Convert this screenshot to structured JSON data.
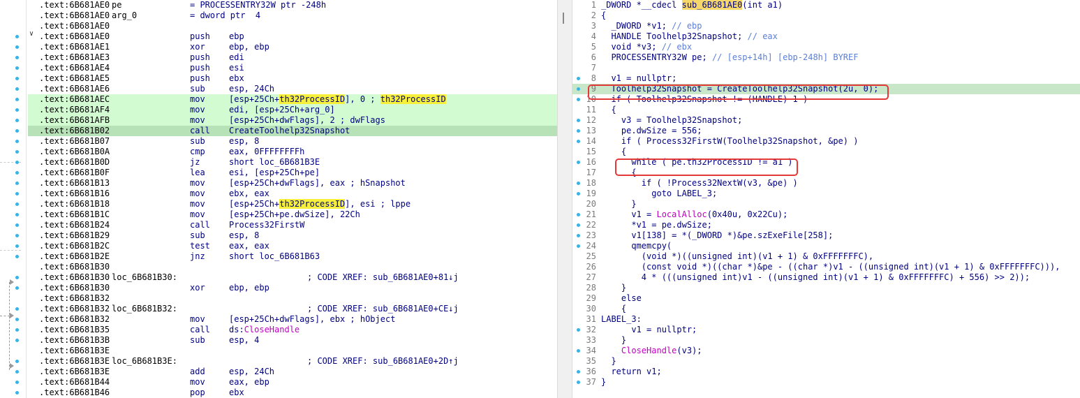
{
  "asm": {
    "lines": [
      {
        "addr": ".text:6B681AE0",
        "label": "pe",
        "plain": "= PROCESSENTRY32W ptr -248h"
      },
      {
        "addr": ".text:6B681AE0",
        "label": "arg_0",
        "plain": "= dword ptr  4"
      },
      {
        "addr": ".text:6B681AE0"
      },
      {
        "addr": ".text:6B681AE0",
        "mnem": "push",
        "ops": "ebp"
      },
      {
        "addr": ".text:6B681AE1",
        "mnem": "xor",
        "ops": "ebp, ebp"
      },
      {
        "addr": ".text:6B681AE3",
        "mnem": "push",
        "ops": "edi"
      },
      {
        "addr": ".text:6B681AE4",
        "mnem": "push",
        "ops": "esi"
      },
      {
        "addr": ".text:6B681AE5",
        "mnem": "push",
        "ops": "ebx"
      },
      {
        "addr": ".text:6B681AE6",
        "mnem": "sub",
        "ops": "esp, 24Ch"
      },
      {
        "addr": ".text:6B681AEC",
        "mnem": "mov",
        "ops_a": "[esp+25Ch+",
        "ops_hl": "th32ProcessID",
        "ops_b": "], 0 ; ",
        "ops_hl2": "th32ProcessID",
        "hl": "green"
      },
      {
        "addr": ".text:6B681AF4",
        "mnem": "mov",
        "ops": "edi, [esp+25Ch+arg_0]",
        "hl": "green"
      },
      {
        "addr": ".text:6B681AFB",
        "mnem": "mov",
        "ops": "[esp+25Ch+dwFlags], 2 ; dwFlags",
        "hl": "green"
      },
      {
        "addr": ".text:6B681B02",
        "mnem": "call",
        "ops": "CreateToolhelp32Snapshot",
        "hl": "cur"
      },
      {
        "addr": ".text:6B681B07",
        "mnem": "sub",
        "ops": "esp, 8"
      },
      {
        "addr": ".text:6B681B0A",
        "mnem": "cmp",
        "ops": "eax, 0FFFFFFFFh"
      },
      {
        "addr": ".text:6B681B0D",
        "mnem": "jz",
        "ops": "short loc_6B681B3E"
      },
      {
        "addr": ".text:6B681B0F",
        "mnem": "lea",
        "ops": "esi, [esp+25Ch+pe]"
      },
      {
        "addr": ".text:6B681B13",
        "mnem": "mov",
        "ops": "[esp+25Ch+dwFlags], eax ; hSnapshot"
      },
      {
        "addr": ".text:6B681B16",
        "mnem": "mov",
        "ops": "ebx, eax"
      },
      {
        "addr": ".text:6B681B18",
        "mnem": "mov",
        "ops_a": "[esp+25Ch+",
        "ops_hl": "th32ProcessID",
        "ops_b": "], esi ; lppe"
      },
      {
        "addr": ".text:6B681B1C",
        "mnem": "mov",
        "ops": "[esp+25Ch+pe.dwSize], 22Ch"
      },
      {
        "addr": ".text:6B681B24",
        "mnem": "call",
        "ops": "Process32FirstW"
      },
      {
        "addr": ".text:6B681B29",
        "mnem": "sub",
        "ops": "esp, 8"
      },
      {
        "addr": ".text:6B681B2C",
        "mnem": "test",
        "ops": "eax, eax"
      },
      {
        "addr": ".text:6B681B2E",
        "mnem": "jnz",
        "ops": "short loc_6B681B63"
      },
      {
        "addr": ".text:6B681B30"
      },
      {
        "addr": ".text:6B681B30",
        "label": "loc_6B681B30:",
        "cmt": "; CODE XREF: sub_6B681AE0+81↓j"
      },
      {
        "addr": ".text:6B681B30",
        "mnem": "xor",
        "ops": "ebp, ebp"
      },
      {
        "addr": ".text:6B681B32"
      },
      {
        "addr": ".text:6B681B32",
        "label": "loc_6B681B32:",
        "cmt": "; CODE XREF: sub_6B681AE0+CE↓j"
      },
      {
        "addr": ".text:6B681B32",
        "mnem": "mov",
        "ops": "[esp+25Ch+dwFlags], ebx ; hObject"
      },
      {
        "addr": ".text:6B681B35",
        "mnem": "call",
        "ops_a": "ds:",
        "ops_purple": "CloseHandle"
      },
      {
        "addr": ".text:6B681B3B",
        "mnem": "sub",
        "ops": "esp, 4"
      },
      {
        "addr": ".text:6B681B3E"
      },
      {
        "addr": ".text:6B681B3E",
        "label": "loc_6B681B3E:",
        "cmt": "; CODE XREF: sub_6B681AE0+2D↑j"
      },
      {
        "addr": ".text:6B681B3E",
        "mnem": "add",
        "ops": "esp, 24Ch"
      },
      {
        "addr": ".text:6B681B44",
        "mnem": "mov",
        "ops": "eax, ebp"
      },
      {
        "addr": ".text:6B681B46",
        "mnem": "pop",
        "ops": "ebx"
      }
    ]
  },
  "pseudocode": {
    "lines": [
      {
        "n": "1",
        "pre": "_DWORD *__cdecl ",
        "fn": "sub_6B681AE0",
        "post": "(int a1)"
      },
      {
        "n": "2",
        "text": "{"
      },
      {
        "n": "3",
        "text": "  _DWORD *v1; ",
        "cmt": "// ebp"
      },
      {
        "n": "4",
        "text": "  HANDLE Toolhelp32Snapshot; ",
        "cmt": "// eax"
      },
      {
        "n": "5",
        "text": "  void *v3; ",
        "cmt": "// ebx"
      },
      {
        "n": "6",
        "text": "  PROCESSENTRY32W pe; ",
        "cmt": "// [esp+14h] [ebp-248h] BYREF"
      },
      {
        "n": "7",
        "text": ""
      },
      {
        "n": "8",
        "text": "  v1 = nullptr;",
        "dot": true
      },
      {
        "n": "9",
        "text": "  Toolhelp32Snapshot = CreateToolhelp32Snapshot(2u, 0);",
        "dot": true,
        "hl": "cur"
      },
      {
        "n": "10",
        "text": "  if ( Toolhelp32Snapshot != (HANDLE)-1 )",
        "dot": true
      },
      {
        "n": "11",
        "text": "  {"
      },
      {
        "n": "12",
        "text": "    v3 = Toolhelp32Snapshot;",
        "dot": true
      },
      {
        "n": "13",
        "text": "    pe.dwSize = 556;",
        "dot": true
      },
      {
        "n": "14",
        "text": "    if ( Process32FirstW(Toolhelp32Snapshot, &pe) )",
        "dot": true
      },
      {
        "n": "15",
        "text": "    {"
      },
      {
        "n": "16",
        "text": "      while ( pe.th32ProcessID != a1 )",
        "dot": true
      },
      {
        "n": "17",
        "text": "      {"
      },
      {
        "n": "18",
        "text": "        if ( !Process32NextW(v3, &pe) )",
        "dot": true
      },
      {
        "n": "19",
        "text": "          goto LABEL_3;",
        "dot": true
      },
      {
        "n": "20",
        "text": "      }"
      },
      {
        "n": "21",
        "text": "      v1 = ",
        "fcall": "LocalAlloc",
        "rest": "(0x40u, 0x22Cu);",
        "dot": true
      },
      {
        "n": "22",
        "text": "      *v1 = pe.dwSize;",
        "dot": true
      },
      {
        "n": "23",
        "text": "      v1[138] = *(_DWORD *)&pe.szExeFile[258];",
        "dot": true
      },
      {
        "n": "24",
        "text": "      qmemcpy(",
        "dot": true
      },
      {
        "n": "25",
        "text": "        (void *)((unsigned int)(v1 + 1) & 0xFFFFFFFC),"
      },
      {
        "n": "26",
        "text": "        (const void *)((char *)&pe - ((char *)v1 - ((unsigned int)(v1 + 1) & 0xFFFFFFFC))),"
      },
      {
        "n": "27",
        "text": "        4 * (((unsigned int)v1 - ((unsigned int)(v1 + 1) & 0xFFFFFFFC) + 556) >> 2));"
      },
      {
        "n": "28",
        "text": "    }"
      },
      {
        "n": "29",
        "text": "    else"
      },
      {
        "n": "30",
        "text": "    {"
      },
      {
        "n": "31",
        "text": "LABEL_3:"
      },
      {
        "n": "32",
        "text": "      v1 = nullptr;",
        "dot": true
      },
      {
        "n": "33",
        "text": "    }"
      },
      {
        "n": "34",
        "text": "    ",
        "fcall": "CloseHandle",
        "rest": "(v3);",
        "dot": true
      },
      {
        "n": "35",
        "text": "  }"
      },
      {
        "n": "36",
        "text": "  return v1;",
        "dot": true
      },
      {
        "n": "37",
        "text": "}",
        "dot": true
      }
    ]
  },
  "colors": {
    "highlight_green": "#d2fbd2",
    "highlight_current": "#b7e2b7",
    "word_highlight": "#f6f03a",
    "breakpoint_dot": "#39b3e6",
    "annotation_box": "#e53838",
    "import_purple": "#c000c0"
  }
}
